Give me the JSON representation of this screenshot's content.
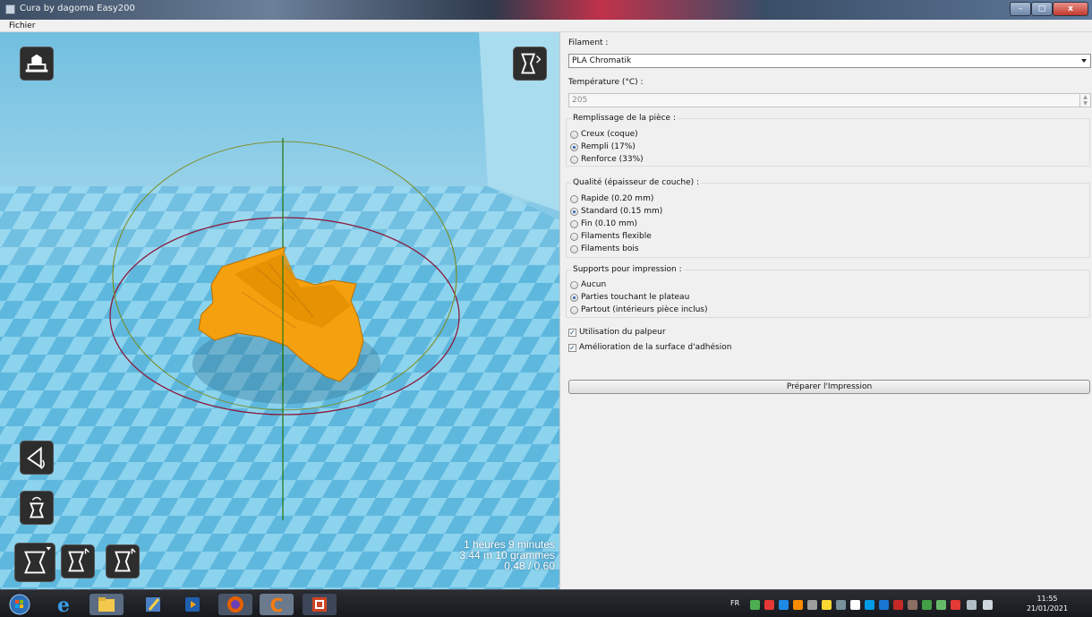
{
  "window": {
    "title": "Cura by dagoma Easy200",
    "minimize": "–",
    "maximize": "□",
    "close": "x"
  },
  "menu": {
    "items": [
      "Fichier"
    ]
  },
  "viewport": {
    "print_info": {
      "time": "1 heures 9 minutes",
      "material": "3.44 m 10 grammes",
      "ratio": "0.48 / 0.60"
    },
    "tools": [
      "load-model-icon",
      "view-mode-icon",
      "rotate-icon",
      "lay-flat-icon",
      "scale-icon",
      "mirror-icon",
      "mirror-alt-icon"
    ]
  },
  "panel": {
    "filament": {
      "label": "Filament :",
      "value": "PLA Chromatik"
    },
    "temperature": {
      "label": "Température (°C) :",
      "value": "205"
    },
    "infill": {
      "title": "Remplissage de la pièce :",
      "options": [
        "Creux (coque)",
        "Rempli (17%)",
        "Renforce (33%)"
      ],
      "selected": "Rempli (17%)"
    },
    "quality": {
      "title": "Qualité (épaisseur de couche) :",
      "options": [
        "Rapide (0.20 mm)",
        "Standard (0.15 mm)",
        "Fin (0.10 mm)",
        "Filaments flexible",
        "Filaments bois"
      ],
      "selected": "Standard (0.15 mm)"
    },
    "supports": {
      "title": "Supports pour impression :",
      "options": [
        "Aucun",
        "Parties touchant le plateau",
        "Partout (intérieurs pièce inclus)"
      ],
      "selected": "Parties touchant le plateau"
    },
    "checkboxes": [
      {
        "label": "Utilisation du palpeur",
        "checked": true
      },
      {
        "label": "Amélioration de la surface d'adhésion",
        "checked": true
      }
    ],
    "prepare_button": "Préparer l'Impression"
  },
  "taskbar": {
    "language": "FR",
    "time": "11:55",
    "date": "21/01/2021",
    "apps": [
      "start-orb-icon",
      "internet-explorer-icon",
      "file-explorer-icon",
      "paint-icon",
      "media-player-icon",
      "firefox-icon",
      "cura-icon",
      "presentation-icon"
    ]
  },
  "colors": {
    "model": "#f5a00f",
    "floor_light": "#8cd3ee",
    "floor_dark": "#5cb6dd",
    "accent_radio": "#2a63b6"
  }
}
